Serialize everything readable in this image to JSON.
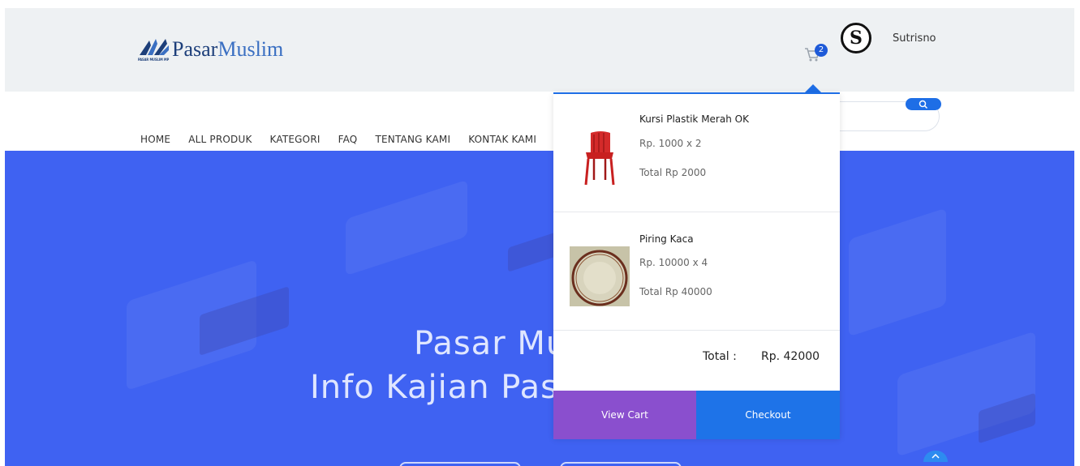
{
  "header": {
    "logo_main_1": "Pasar",
    "logo_main_2": "Muslim",
    "logo_sub": "PASAR MUSLIM MP",
    "cart_count": "2",
    "avatar_letter": "S",
    "username": "Sutrisno"
  },
  "nav": {
    "items": [
      "HOME",
      "ALL PRODUK",
      "KATEGORI",
      "FAQ",
      "TENTANG KAMI",
      "KONTAK KAMI"
    ]
  },
  "hero": {
    "line1": "Pasar Muslim",
    "line2": "Info Kajian Pasar"
  },
  "cart_dropdown": {
    "items": [
      {
        "name": "Kursi Plastik Merah OK",
        "price": "Rp. 1000 x 2",
        "total": "Total Rp 2000",
        "image_icon": "red-chair-image"
      },
      {
        "name": "Piring Kaca",
        "price": "Rp. 10000 x 4",
        "total": "Total Rp 40000",
        "image_icon": "glass-plate-image"
      }
    ],
    "total_label": "Total :",
    "total_value": "Rp. 42000",
    "view_cart_label": "View Cart",
    "checkout_label": "Checkout"
  },
  "colors": {
    "hero_bg": "#3f62f2",
    "accent": "#1e73e8",
    "view_cart": "#8a4fce"
  }
}
